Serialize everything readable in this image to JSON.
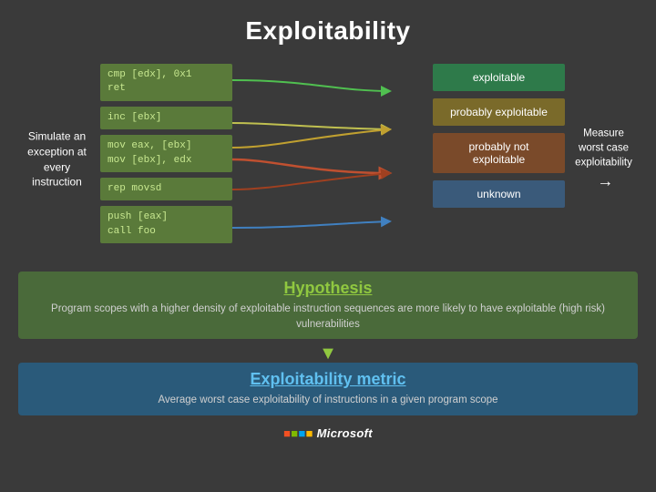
{
  "title": "Exploitability",
  "simulate": {
    "label": "Simulate an exception at every instruction"
  },
  "code_boxes": [
    {
      "id": "cb1",
      "code": "cmp [edx], 0x1\nret"
    },
    {
      "id": "cb2",
      "code": "inc [ebx]"
    },
    {
      "id": "cb3",
      "code": "mov eax, [ebx]\nmov [ebx], edx"
    },
    {
      "id": "cb4",
      "code": "rep movsd"
    },
    {
      "id": "cb5",
      "code": "push [eax]\ncall foo"
    }
  ],
  "result_boxes": [
    {
      "id": "rb1",
      "label": "exploitable",
      "class": "result-exploitable"
    },
    {
      "id": "rb2",
      "label": "probably exploitable",
      "class": "result-probably-exploitable"
    },
    {
      "id": "rb3",
      "label": "probably not exploitable",
      "class": "result-probably-not"
    },
    {
      "id": "rb4",
      "label": "unknown",
      "class": "result-unknown"
    }
  ],
  "measure": {
    "label": "Measure worst case exploitability"
  },
  "hypothesis": {
    "title": "Hypothesis",
    "text": "Program scopes with a higher density of exploitable instruction sequences are more likely to have exploitable (high risk) vulnerabilities"
  },
  "metric": {
    "title": "Exploitability metric",
    "text": "Average worst case exploitability of instructions in a given program scope"
  },
  "microsoft": {
    "label": "Microsoft"
  }
}
